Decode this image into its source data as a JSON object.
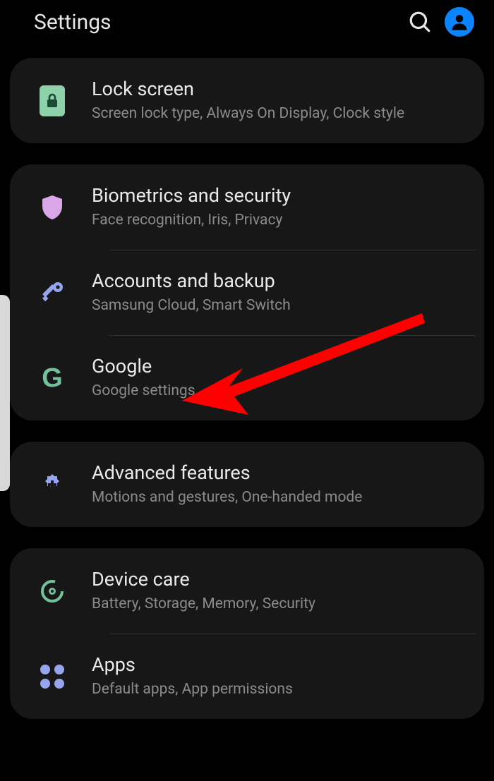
{
  "header": {
    "title": "Settings"
  },
  "groups": [
    {
      "items": [
        {
          "title": "Lock screen",
          "subtitle": "Screen lock type, Always On Display, Clock style"
        }
      ]
    },
    {
      "items": [
        {
          "title": "Biometrics and security",
          "subtitle": "Face recognition, Iris, Privacy"
        },
        {
          "title": "Accounts and backup",
          "subtitle": "Samsung Cloud, Smart Switch"
        },
        {
          "title": "Google",
          "subtitle": "Google settings"
        }
      ]
    },
    {
      "items": [
        {
          "title": "Advanced features",
          "subtitle": "Motions and gestures, One-handed mode"
        }
      ]
    },
    {
      "items": [
        {
          "title": "Device care",
          "subtitle": "Battery, Storage, Memory, Security"
        },
        {
          "title": "Apps",
          "subtitle": "Default apps, App permissions"
        }
      ]
    }
  ]
}
